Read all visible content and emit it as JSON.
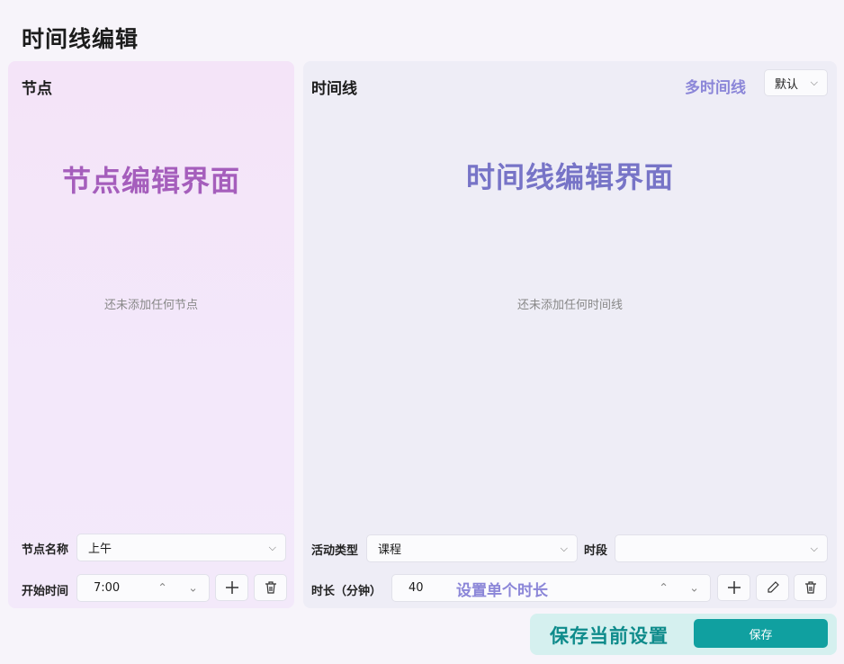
{
  "page": {
    "title": "时间线编辑"
  },
  "node_panel": {
    "title": "节点",
    "annotation": "节点编辑界面",
    "empty_text": "还未添加任何节点",
    "name_label": "节点名称",
    "name_value": "上午",
    "start_label": "开始时间",
    "start_value": "7:00"
  },
  "timeline_panel": {
    "title": "时间线",
    "multi_annotation": "多时间线",
    "select_value": "默认",
    "annotation": "时间线编辑界面",
    "empty_text": "还未添加任何时间线",
    "activity_label": "活动类型",
    "activity_value": "课程",
    "period_label": "时段",
    "period_value": "",
    "duration_label": "时长（分钟）",
    "duration_value": "40",
    "duration_annotation": "设置单个时长"
  },
  "save_bar": {
    "annotation": "保存当前设置",
    "save_label": "保存"
  },
  "colors": {
    "accent": "#10a0a0",
    "node_annotation": "#a55ebc",
    "timeline_annotation": "#7774c7"
  }
}
